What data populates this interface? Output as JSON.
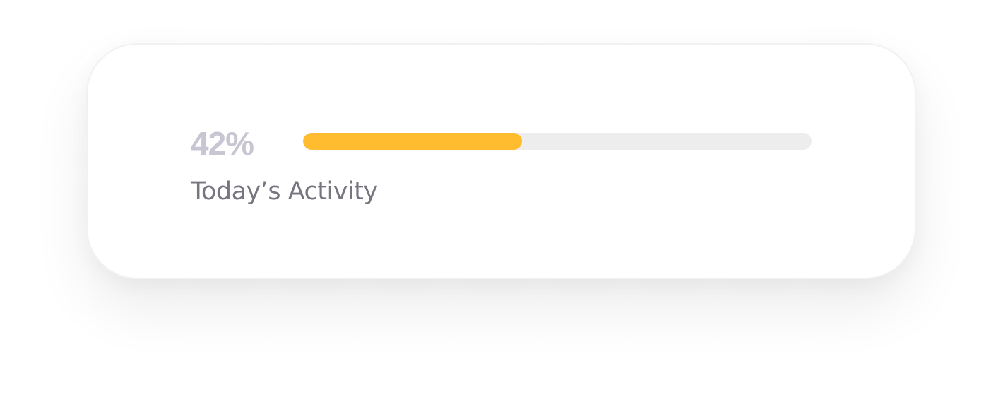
{
  "activity": {
    "percent_text": "42%",
    "progress_fraction": 0.43,
    "label": "Today’s Activity",
    "colors": {
      "fill": "#ffbc2e",
      "track": "#ededed",
      "percent": "#c7c6d2",
      "label": "#77757f"
    }
  }
}
